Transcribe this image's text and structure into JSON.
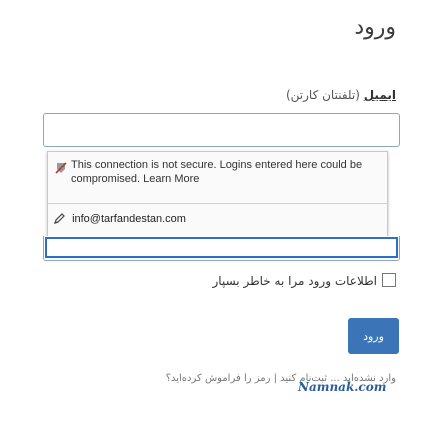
{
  "form": {
    "title": "ورود",
    "field_label": "ایمیل",
    "field_hint": "(تلفنتان کارتن)",
    "remember_label": "اطلاعات ورود مرا به خاطر بسپار",
    "submit_label": "ورود",
    "footer_text": "وارد نشده‌اید ... ثبت‌نام کنید | رمز را فراموش کرده‌اید؟"
  },
  "autofill_popup": {
    "warning_text": "This connection is not secure. Logins entered here could be compromised. Learn More",
    "suggestion": "info@tarfandestan.com"
  },
  "watermark": "Namnak.com",
  "colors": {
    "accent": "#3b75b7",
    "focus_border": "#2c6fc8",
    "watermark": "#2a5c9c"
  }
}
